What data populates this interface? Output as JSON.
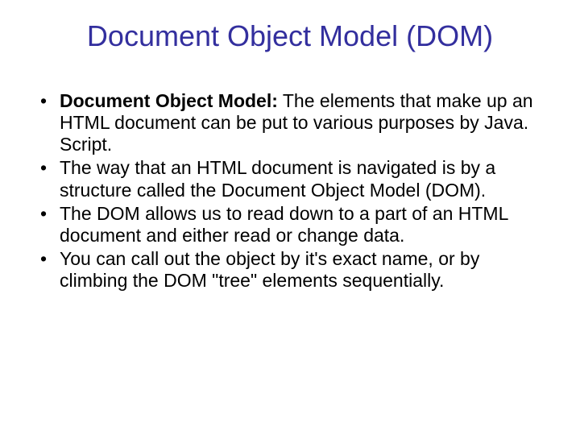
{
  "title": "Document Object Model (DOM)",
  "bullets": [
    {
      "lead": "Document Object Model:",
      "rest": " The elements that make up an HTML document can be put to various purposes by Java. Script."
    },
    {
      "text": "The way that an HTML document is navigated is by a structure called the Document Object Model (DOM)."
    },
    {
      "text": "The DOM allows us to read down to a part of an HTML document and either read or change data."
    },
    {
      "text": "You can call out the object by it's exact name, or by climbing the DOM \"tree\" elements sequentially."
    }
  ]
}
